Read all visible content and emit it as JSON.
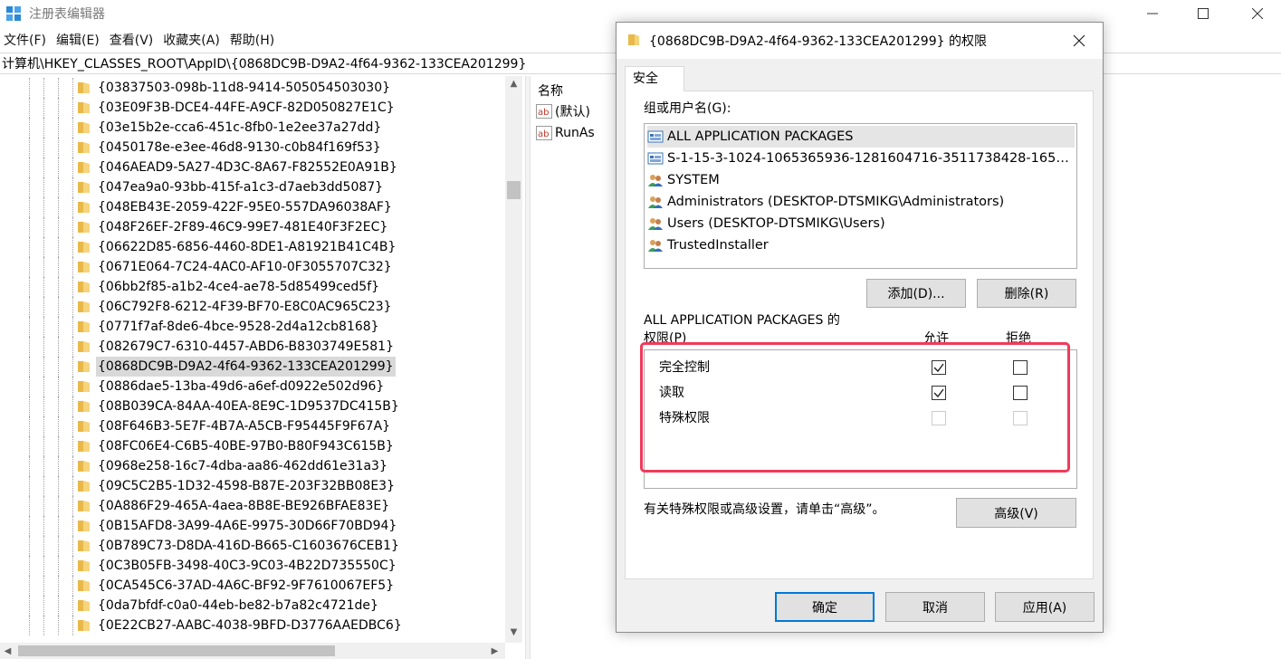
{
  "app": {
    "title": "注册表编辑器",
    "icon": "registry-editor-icon"
  },
  "menu": [
    "文件(F)",
    "编辑(E)",
    "查看(V)",
    "收藏夹(A)",
    "帮助(H)"
  ],
  "address": "计算机\\HKEY_CLASSES_ROOT\\AppID\\{0868DC9B-D9A2-4f64-9362-133CEA201299}",
  "tree": {
    "items": [
      "{03837503-098b-11d8-9414-505054503030}",
      "{03E09F3B-DCE4-44FE-A9CF-82D050827E1C}",
      "{03e15b2e-cca6-451c-8fb0-1e2ee37a27dd}",
      "{0450178e-e3ee-46d8-9130-c0b84f169f53}",
      "{046AEAD9-5A27-4D3C-8A67-F82552E0A91B}",
      "{047ea9a0-93bb-415f-a1c3-d7aeb3dd5087}",
      "{048EB43E-2059-422F-95E0-557DA96038AF}",
      "{048F26EF-2F89-46C9-99E7-481E40F3F2EC}",
      "{06622D85-6856-4460-8DE1-A81921B41C4B}",
      "{0671E064-7C24-4AC0-AF10-0F3055707C32}",
      "{06bb2f85-a1b2-4ce4-ae78-5d85499ced5f}",
      "{06C792F8-6212-4F39-BF70-E8C0AC965C23}",
      "{0771f7af-8de6-4bce-9528-2d4a12cb8168}",
      "{082679C7-6310-4457-ABD6-B8303749E581}",
      "{0868DC9B-D9A2-4f64-9362-133CEA201299}",
      "{0886dae5-13ba-49d6-a6ef-d0922e502d96}",
      "{08B039CA-84AA-40EA-8E9C-1D9537DC415B}",
      "{08F646B3-5E7F-4B7A-A5CB-F95445F9F67A}",
      "{08FC06E4-C6B5-40BE-97B0-B80F943C615B}",
      "{0968e258-16c7-4dba-aa86-462dd61e31a3}",
      "{09C5C2B5-1D32-4598-B87E-203F32BB08E3}",
      "{0A886F29-465A-4aea-8B8E-BE926BFAE83E}",
      "{0B15AFD8-3A99-4A6E-9975-30D66F70BD94}",
      "{0B789C73-D8DA-416D-B665-C1603676CEB1}",
      "{0C3B05FB-3498-40C3-9C03-4B22D735550C}",
      "{0CA545C6-37AD-4A6C-BF92-9F7610067EF5}",
      "{0da7bfdf-c0a0-44eb-be82-b7a82c4721de}",
      "{0E22CB27-AABC-4038-9BFD-D3776AAEDBC6}"
    ],
    "selected_index": 14
  },
  "values_pane": {
    "header": "名称",
    "values": [
      {
        "name": "(默认)",
        "icon": "string-value-icon"
      },
      {
        "name": "RunAs",
        "icon": "string-value-icon"
      }
    ]
  },
  "dialog": {
    "title": "{0868DC9B-D9A2-4f64-9362-133CEA201299} 的权限",
    "tab": "安全",
    "group_label": "组或用户名(G):",
    "users": [
      {
        "name": "ALL APPLICATION PACKAGES",
        "icon": "app-packages-icon",
        "selected": true
      },
      {
        "name": "S-1-15-3-1024-1065365936-1281604716-3511738428-1654...",
        "icon": "app-packages-icon",
        "selected": false
      },
      {
        "name": "SYSTEM",
        "icon": "users-group-icon",
        "selected": false
      },
      {
        "name": "Administrators (DESKTOP-DTSMIKG\\Administrators)",
        "icon": "users-group-icon",
        "selected": false
      },
      {
        "name": "Users (DESKTOP-DTSMIKG\\Users)",
        "icon": "users-group-icon",
        "selected": false
      },
      {
        "name": "TrustedInstaller",
        "icon": "users-group-icon",
        "selected": false
      }
    ],
    "add_button": "添加(D)...",
    "remove_button": "删除(R)",
    "perm_for_line1": "ALL APPLICATION PACKAGES 的",
    "perm_for_line2": "权限(P)",
    "allow_header": "允许",
    "deny_header": "拒绝",
    "permissions": [
      {
        "name": "完全控制",
        "allow": true,
        "deny": false,
        "enabled": true
      },
      {
        "name": "读取",
        "allow": true,
        "deny": false,
        "enabled": true
      },
      {
        "name": "特殊权限",
        "allow": false,
        "deny": false,
        "enabled": false
      }
    ],
    "advanced_note": "有关特殊权限或高级设置，请单击“高级”。",
    "advanced_button": "高级(V)",
    "ok_button": "确定",
    "cancel_button": "取消",
    "apply_button": "应用(A)"
  },
  "colors": {
    "highlight_box": "#f03a5a",
    "folder": "#e8b94a",
    "default_button_border": "#0078d7"
  }
}
